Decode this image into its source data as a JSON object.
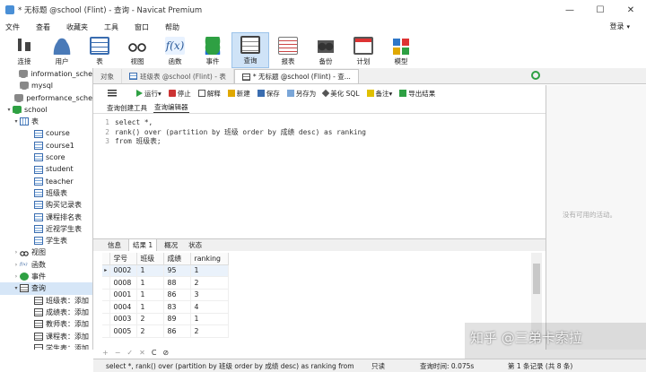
{
  "window": {
    "title": "* 无标题 @school (Flint) - 查询 - Navicat Premium"
  },
  "window_controls": {
    "minimize": "—",
    "maximize": "☐",
    "close": "✕"
  },
  "menu": [
    "文件",
    "查看",
    "收藏夹",
    "工具",
    "窗口",
    "帮助"
  ],
  "login": {
    "label": "登录",
    "chevron": "▾"
  },
  "toolbar": [
    {
      "label": "连接",
      "icon": "connect-icon"
    },
    {
      "label": "用户",
      "icon": "user-icon"
    },
    {
      "label": "表",
      "icon": "table-icon"
    },
    {
      "label": "视图",
      "icon": "view-icon"
    },
    {
      "label": "函数",
      "icon": "function-icon"
    },
    {
      "label": "事件",
      "icon": "event-icon"
    },
    {
      "label": "查询",
      "icon": "query-icon",
      "active": true
    },
    {
      "label": "报表",
      "icon": "report-icon"
    },
    {
      "label": "备份",
      "icon": "backup-icon"
    },
    {
      "label": "计划",
      "icon": "schedule-icon"
    },
    {
      "label": "模型",
      "icon": "model-icon"
    }
  ],
  "toolbar_func_glyph": "f(x)",
  "sidebar": {
    "items": [
      {
        "label": "information_sche",
        "kind": "db",
        "indent": 1,
        "caret": ""
      },
      {
        "label": "mysql",
        "kind": "db",
        "indent": 1,
        "caret": ""
      },
      {
        "label": "performance_sche",
        "kind": "db",
        "indent": 1,
        "caret": ""
      },
      {
        "label": "school",
        "kind": "db-on",
        "indent": 0,
        "caret": "▾"
      },
      {
        "label": "表",
        "kind": "grp",
        "indent": 1,
        "caret": "▾"
      },
      {
        "label": "course",
        "kind": "tbl",
        "indent": 3,
        "caret": ""
      },
      {
        "label": "course1",
        "kind": "tbl",
        "indent": 3,
        "caret": ""
      },
      {
        "label": "score",
        "kind": "tbl",
        "indent": 3,
        "caret": ""
      },
      {
        "label": "student",
        "kind": "tbl",
        "indent": 3,
        "caret": ""
      },
      {
        "label": "teacher",
        "kind": "tbl",
        "indent": 3,
        "caret": ""
      },
      {
        "label": "班级表",
        "kind": "tbl",
        "indent": 3,
        "caret": ""
      },
      {
        "label": "购买记录表",
        "kind": "tbl",
        "indent": 3,
        "caret": ""
      },
      {
        "label": "课程排名表",
        "kind": "tbl",
        "indent": 3,
        "caret": ""
      },
      {
        "label": "近视学生表",
        "kind": "tbl",
        "indent": 3,
        "caret": ""
      },
      {
        "label": "学生表",
        "kind": "tbl",
        "indent": 3,
        "caret": ""
      },
      {
        "label": "视图",
        "kind": "view",
        "indent": 1,
        "caret": "›"
      },
      {
        "label": "函数",
        "kind": "func",
        "indent": 1,
        "caret": "›"
      },
      {
        "label": "事件",
        "kind": "event",
        "indent": 1,
        "caret": "›"
      },
      {
        "label": "查询",
        "kind": "query",
        "indent": 1,
        "caret": "▾",
        "selected": true
      },
      {
        "label": "班级表：添加",
        "kind": "query",
        "indent": 3,
        "caret": ""
      },
      {
        "label": "成绩表：添加",
        "kind": "query",
        "indent": 3,
        "caret": ""
      },
      {
        "label": "教师表：添加",
        "kind": "query",
        "indent": 3,
        "caret": ""
      },
      {
        "label": "课程表：添加",
        "kind": "query",
        "indent": 3,
        "caret": ""
      },
      {
        "label": "学生表：添加",
        "kind": "query",
        "indent": 3,
        "caret": ""
      }
    ]
  },
  "tabs": [
    {
      "label": "对象",
      "active": false
    },
    {
      "label": "班级表 @school (Flint) - 表",
      "active": false
    },
    {
      "label": "* 无标题 @school (Flint) - 查...",
      "active": true
    }
  ],
  "query_toolbar": {
    "run": "运行",
    "run_chevron": "▾",
    "stop": "停止",
    "explain": "解释",
    "new": "新建",
    "save": "保存",
    "saveas": "另存为",
    "beautify": "美化 SQL",
    "note": "备注",
    "note_chevron": "▾",
    "export": "导出结果"
  },
  "subtabs": [
    "查询创建工具",
    "查询编辑器"
  ],
  "editor": {
    "lines": [
      {
        "n": "1",
        "text": "select *,"
      },
      {
        "n": "2",
        "text": "rank() over (partition by 班级 order by 成绩 desc) as ranking"
      },
      {
        "n": "3",
        "text": "from 班级表;"
      }
    ]
  },
  "right_panel": {
    "empty_text": "没有可用的活动。"
  },
  "result_tabs": [
    "信息",
    "结果 1",
    "概况",
    "状态"
  ],
  "result": {
    "columns": [
      "学号",
      "班级",
      "成绩",
      "ranking"
    ],
    "rows": [
      [
        "0002",
        "1",
        "95",
        "1"
      ],
      [
        "0008",
        "1",
        "88",
        "2"
      ],
      [
        "0001",
        "1",
        "86",
        "3"
      ],
      [
        "0004",
        "1",
        "83",
        "4"
      ],
      [
        "0003",
        "2",
        "89",
        "1"
      ],
      [
        "0005",
        "2",
        "86",
        "2"
      ]
    ],
    "current_row_marker": "▸"
  },
  "grid_nav": [
    "+",
    "−",
    "✓",
    "✕",
    "C",
    "⊘"
  ],
  "status": {
    "sql": "select *, rank() over (partition by 班级 order by 成绩 desc) as ranking  from",
    "readonly": "只读",
    "query_time": "查询时间: 0.075s",
    "record": "第 1 条记录 (共 8 条)"
  },
  "watermark": "知乎 @三弟卡索拉"
}
